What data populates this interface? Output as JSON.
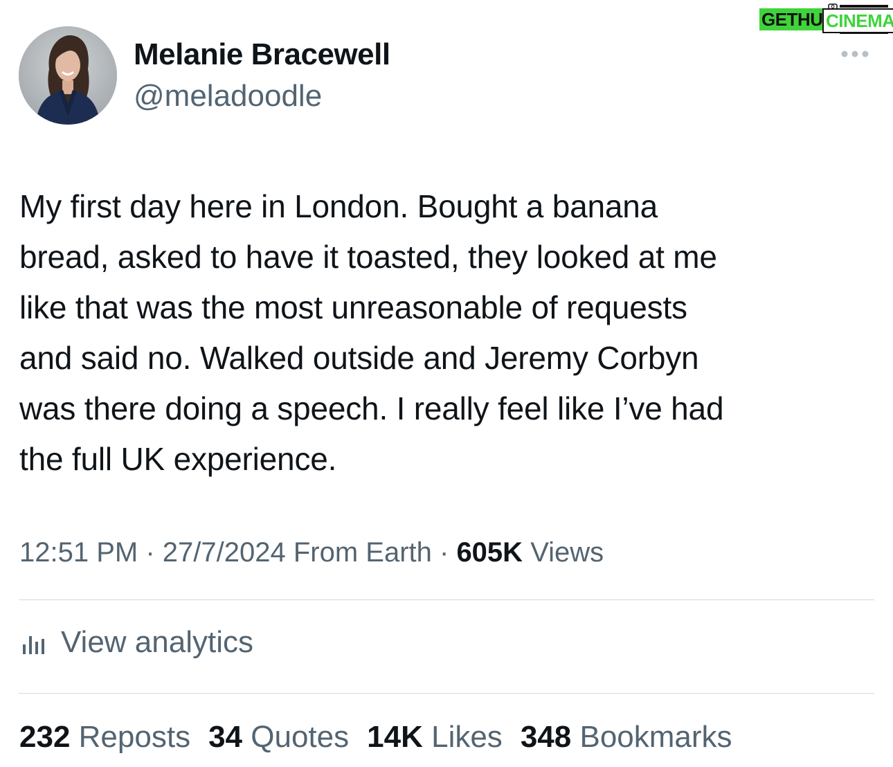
{
  "watermark": {
    "left_text": "GETHU",
    "right_text": "CINEMA"
  },
  "author": {
    "display_name": "Melanie Bracewell",
    "handle": "@meladoodle"
  },
  "tweet": {
    "lines": [
      "My first day here in London. Bought a banana",
      "bread, asked to have it toasted, they looked at me",
      "like that was the most unreasonable of requests",
      "and said no. Walked outside and Jeremy Corbyn",
      "was there doing a speech. I really feel like I’ve had",
      "the full UK experience."
    ]
  },
  "meta": {
    "time": "12:51 PM",
    "separator": " · ",
    "date": "27/7/2024",
    "location": "From Earth",
    "views_count": "605K",
    "views_label": "Views"
  },
  "analytics": {
    "label": "View analytics",
    "icon": "bar-chart-icon"
  },
  "stats": {
    "reposts_count": "232",
    "reposts_label": "Reposts",
    "quotes_count": "34",
    "quotes_label": "Quotes",
    "likes_count": "14K",
    "likes_label": "Likes",
    "bookmarks_count": "348",
    "bookmarks_label": "Bookmarks"
  },
  "colors": {
    "text_primary": "#0f1419",
    "text_secondary": "#536471",
    "divider": "#cfd9de",
    "watermark_green": "#3fd43a"
  }
}
